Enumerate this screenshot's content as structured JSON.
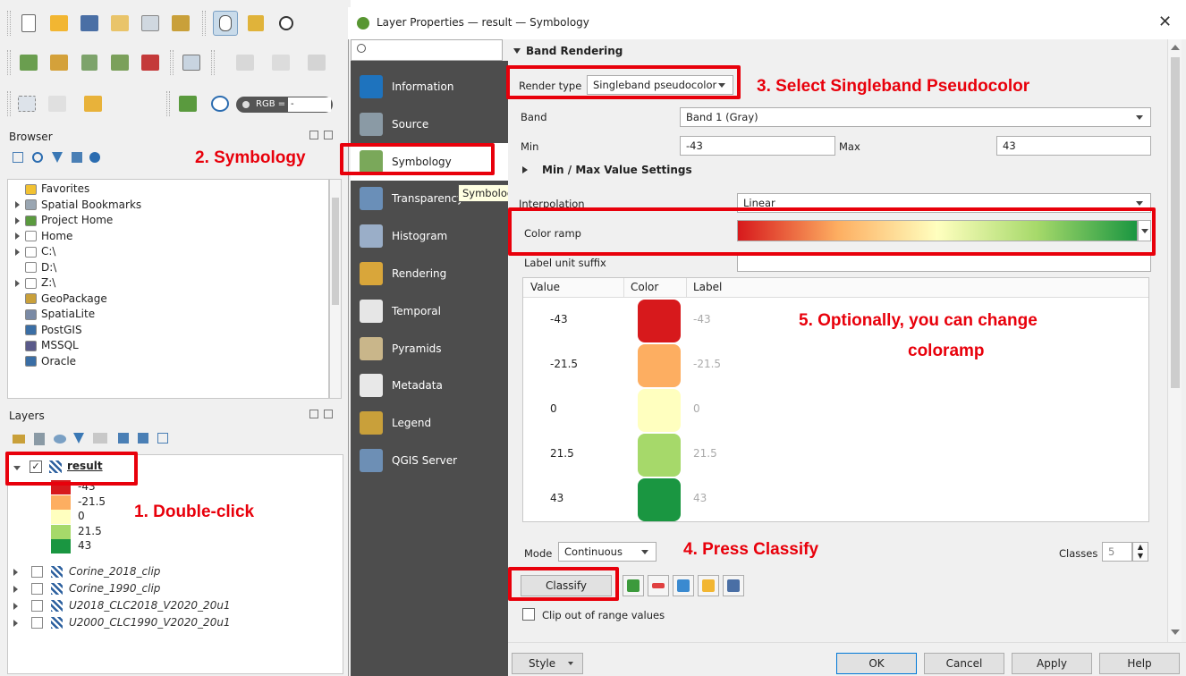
{
  "dialog": {
    "title": "Layer Properties — result — Symbology",
    "search_placeholder": "",
    "sidebar": [
      {
        "label": "Information",
        "icon": "info-icon",
        "color": "#1e73be"
      },
      {
        "label": "Source",
        "icon": "source-icon",
        "color": "#8a9aa5"
      },
      {
        "label": "Symbology",
        "icon": "paintbrush-icon",
        "color": "#7aa85a"
      },
      {
        "label": "Transparency",
        "icon": "transparency-icon",
        "color": "#6a8fb8"
      },
      {
        "label": "Histogram",
        "icon": "histogram-icon",
        "color": "#9aaec8"
      },
      {
        "label": "Rendering",
        "icon": "rendering-brush-icon",
        "color": "#d9a63a"
      },
      {
        "label": "Temporal",
        "icon": "clock-icon",
        "color": "#e6e6e6"
      },
      {
        "label": "Pyramids",
        "icon": "pyramids-icon",
        "color": "#c9b68a"
      },
      {
        "label": "Metadata",
        "icon": "metadata-icon",
        "color": "#e8e8e8"
      },
      {
        "label": "Legend",
        "icon": "legend-icon",
        "color": "#c9a03a"
      },
      {
        "label": "QGIS Server",
        "icon": "server-icon",
        "color": "#6d8fb5"
      }
    ],
    "tooltip": "Symbology",
    "band_rendering": {
      "section_title": "Band Rendering",
      "render_type_label": "Render type",
      "render_type_value": "Singleband pseudocolor",
      "band_label": "Band",
      "band_value": "Band 1 (Gray)",
      "min_label": "Min",
      "min_value": "-43",
      "max_label": "Max",
      "max_value": "43",
      "minmax_settings": "Min / Max Value Settings",
      "interpolation_label": "Interpolation",
      "interpolation_value": "Linear",
      "color_ramp_label": "Color ramp",
      "label_unit_suffix": "Label unit suffix",
      "table_headers": [
        "Value",
        "Color",
        "Label"
      ],
      "classes": [
        {
          "value": "-43",
          "label": "-43",
          "color": "#d7191c"
        },
        {
          "value": "-21.5",
          "label": "-21.5",
          "color": "#fdae61"
        },
        {
          "value": "0",
          "label": "0",
          "color": "#ffffbf"
        },
        {
          "value": "21.5",
          "label": "21.5",
          "color": "#a6d96a"
        },
        {
          "value": "43",
          "label": "43",
          "color": "#1a9641"
        }
      ],
      "mode_label": "Mode",
      "mode_value": "Continuous",
      "classes_label": "Classes",
      "classes_value": "5",
      "classify_button": "Classify",
      "clip_label": "Clip out of range values"
    },
    "footer": {
      "style": "Style",
      "ok": "OK",
      "cancel": "Cancel",
      "apply": "Apply",
      "help": "Help"
    }
  },
  "main_window": {
    "rgb_label": "RGB =",
    "rgb_value": "-",
    "browser_title": "Browser",
    "browser_items": [
      {
        "label": "Favorites",
        "arrow": false
      },
      {
        "label": "Spatial Bookmarks",
        "arrow": true
      },
      {
        "label": "Project Home",
        "arrow": true
      },
      {
        "label": "Home",
        "arrow": true
      },
      {
        "label": "C:\\",
        "arrow": true
      },
      {
        "label": "D:\\",
        "arrow": false
      },
      {
        "label": "Z:\\",
        "arrow": true
      },
      {
        "label": "GeoPackage",
        "arrow": false
      },
      {
        "label": "SpatiaLite",
        "arrow": false
      },
      {
        "label": "PostGIS",
        "arrow": false
      },
      {
        "label": "MSSQL",
        "arrow": false
      },
      {
        "label": "Oracle",
        "arrow": false
      }
    ],
    "layers_title": "Layers",
    "active_layer": "result",
    "legend_items": [
      {
        "label": "-43",
        "color": "#d7191c"
      },
      {
        "label": "-21.5",
        "color": "#fdae61"
      },
      {
        "label": "0",
        "color": "#ffffbf"
      },
      {
        "label": "21.5",
        "color": "#a6d96a"
      },
      {
        "label": "43",
        "color": "#1a9641"
      }
    ],
    "other_layers": [
      "Corine_2018_clip",
      "Corine_1990_clip",
      "U2018_CLC2018_V2020_20u1",
      "U2000_CLC1990_V2020_20u1"
    ]
  },
  "annotations": {
    "a1": "1. Double-click",
    "a2": "2. Symbology",
    "a3": "3. Select Singleband Pseudocolor",
    "a4": "4. Press Classify",
    "a5_line1": "5. Optionally, you can change",
    "a5_line2": "coloramp"
  },
  "colors": {
    "annotation_red": "#e8000b",
    "sidebar_bg": "#4d4d4d"
  }
}
